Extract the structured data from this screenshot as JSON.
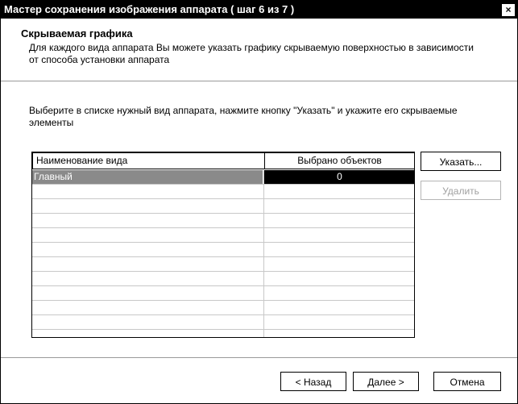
{
  "window": {
    "title": "Мастер сохранения изображения аппарата ( шаг 6 из 7 )",
    "close_label": "×"
  },
  "page": {
    "heading": "Скрываемая графика",
    "description": "Для каждого вида аппарата Вы можете указать графику скрываемую поверхностью в зависимости от способа установки аппарата",
    "instruction": "Выберите в списке нужный вид аппарата, нажмите кнопку \"Указать\" и укажите его скрываемые элементы"
  },
  "list": {
    "columns": [
      "Наименование вида",
      "Выбрано объектов"
    ],
    "rows": [
      {
        "name": "Главный",
        "count": "0",
        "selected": true
      },
      {
        "name": "",
        "count": ""
      },
      {
        "name": "",
        "count": ""
      },
      {
        "name": "",
        "count": ""
      },
      {
        "name": "",
        "count": ""
      },
      {
        "name": "",
        "count": ""
      },
      {
        "name": "",
        "count": ""
      },
      {
        "name": "",
        "count": ""
      },
      {
        "name": "",
        "count": ""
      },
      {
        "name": "",
        "count": ""
      },
      {
        "name": "",
        "count": ""
      },
      {
        "name": "",
        "count": ""
      }
    ]
  },
  "buttons": {
    "specify": "Указать...",
    "delete": "Удалить",
    "back": "< Назад",
    "next": "Далее >",
    "cancel": "Отмена"
  }
}
